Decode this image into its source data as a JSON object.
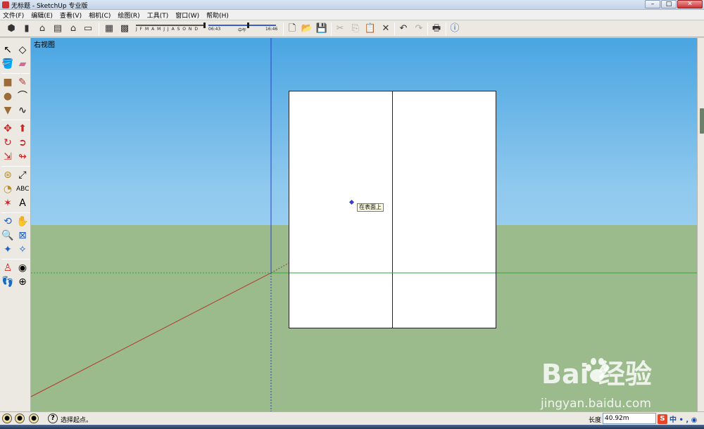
{
  "window": {
    "title": "无标题 - SketchUp 专业版",
    "minimize_label": "–",
    "maximize_label": "□",
    "close_label": "✕"
  },
  "menu": {
    "items": [
      "文件(F)",
      "编辑(E)",
      "查看(V)",
      "相机(C)",
      "绘图(R)",
      "工具(T)",
      "窗口(W)",
      "帮助(H)"
    ]
  },
  "toolbar": {
    "shadow_months": "J F M A M J J A S O N D",
    "time_start": "06:43",
    "time_mid": "中午",
    "time_end": "16:46"
  },
  "viewport": {
    "view_name": "右视图",
    "inference_tooltip": "在表面上",
    "colors": {
      "sky_top": "#4aa5e2",
      "sky_bottom": "#bfe0f6",
      "ground": "#9bbb8d",
      "red_axis": "#b03a2e",
      "green_axis": "#2fa83a",
      "blue_axis": "#2b3fc8",
      "inference_point": "#3a3ad8"
    },
    "watermark": {
      "brand": "Bai  经验",
      "url": "jingyan.baidu.com"
    }
  },
  "statusbar": {
    "status_text": "选择起点。",
    "help_label": "?",
    "measurement_label": "长度",
    "measurement_value": "40.92m",
    "ime_logo": "S",
    "ime_text": "中 • , ◉"
  }
}
